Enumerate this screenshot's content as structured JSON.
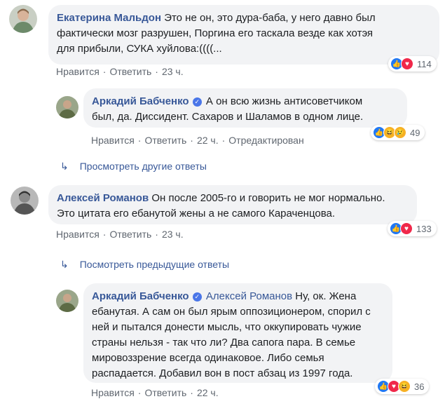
{
  "comments": [
    {
      "author": "Екатерина Мальдон",
      "text_l1": "Это не он, это дура-баба, у него давно был",
      "text_l2": "фактически мозг разрушен, Поргина его таскала везде как хотэя",
      "text_l3": "для прибыли, СУКА хуйлова:((((...",
      "like": "Нравится",
      "reply": "Ответить",
      "time": "23 ч.",
      "reaction_count": "114"
    },
    {
      "author": "Аркадий Бабченко",
      "text_l1": "А он всю жизнь антисоветчиком",
      "text_l2": "был, да. Диссидент. Сахаров и Шаламов в одном лице.",
      "like": "Нравится",
      "reply": "Ответить",
      "time": "22 ч.",
      "edited": "Отредактирован",
      "reaction_count": "49"
    },
    {
      "author": "Алексей Романов",
      "text_l1": "Он после 2005-го и говорить не мог нормально.",
      "text_l2": "Это цитата его ебанутой жены а не самого Караченцова.",
      "like": "Нравится",
      "reply": "Ответить",
      "time": "23 ч.",
      "reaction_count": "133"
    },
    {
      "author": "Аркадий Бабченко",
      "mention": "Алексей Романов",
      "text_l1": "Ну, ок. Жена",
      "text_l2": "ебанутая. А сам он был ярым оппозиционером, спорил с",
      "text_l3": "ней и пытался донести мысль, что оккупировать чужие",
      "text_l4": "страны нельзя - так что ли? Два сапога пара. В семье",
      "text_l5": "мировоззрение всегда одинаковое. Либо семья",
      "text_l6": "распадается. Добавил вон в пост абзац из 1997 года.",
      "like": "Нравится",
      "reply": "Ответить",
      "time": "22 ч.",
      "reaction_count": "36"
    }
  ],
  "links": {
    "other_replies": "Просмотреть другие ответы",
    "previous_replies": "Посмотреть предыдущие ответы"
  },
  "colors": {
    "link": "#385898",
    "bubble": "#f2f3f5",
    "meta": "#606770"
  }
}
